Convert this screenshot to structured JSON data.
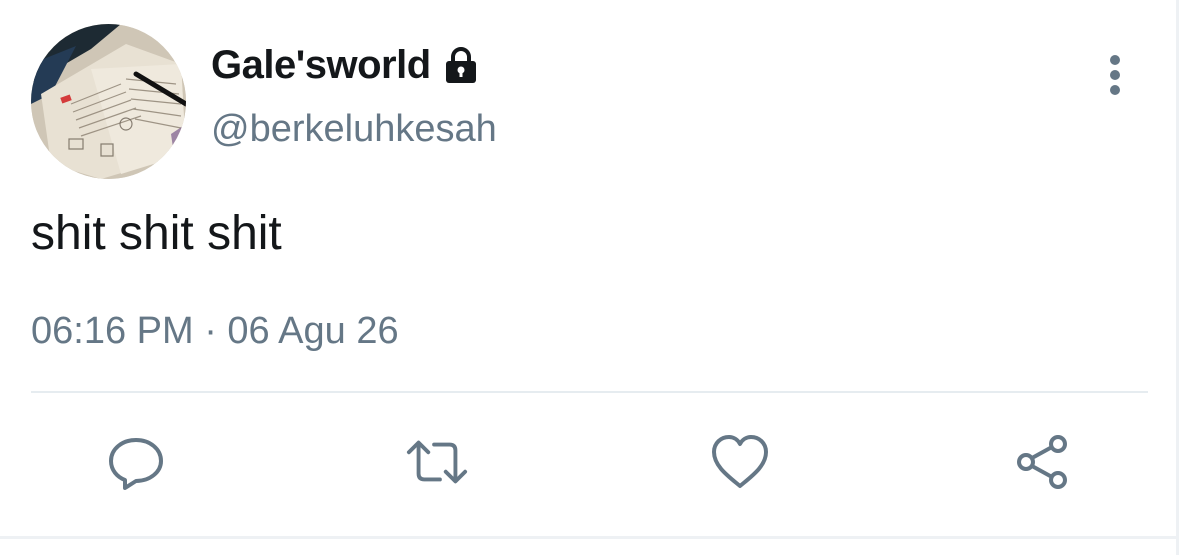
{
  "author": {
    "display_name": "Gale'sworld",
    "handle": "@berkeluhkesah",
    "protected_icon": "lock-icon"
  },
  "tweet": {
    "text": "shit shit shit",
    "timestamp": "06:16 PM · 06 Agu 26"
  },
  "actions": [
    {
      "name": "reply",
      "icon": "reply-icon"
    },
    {
      "name": "retweet",
      "icon": "retweet-icon"
    },
    {
      "name": "like",
      "icon": "heart-icon"
    },
    {
      "name": "share",
      "icon": "share-icon"
    }
  ],
  "menu": {
    "icon": "more-vertical-icon"
  },
  "colors": {
    "text_primary": "#14171a",
    "text_secondary": "#657786",
    "divider": "#e6ecf0"
  }
}
